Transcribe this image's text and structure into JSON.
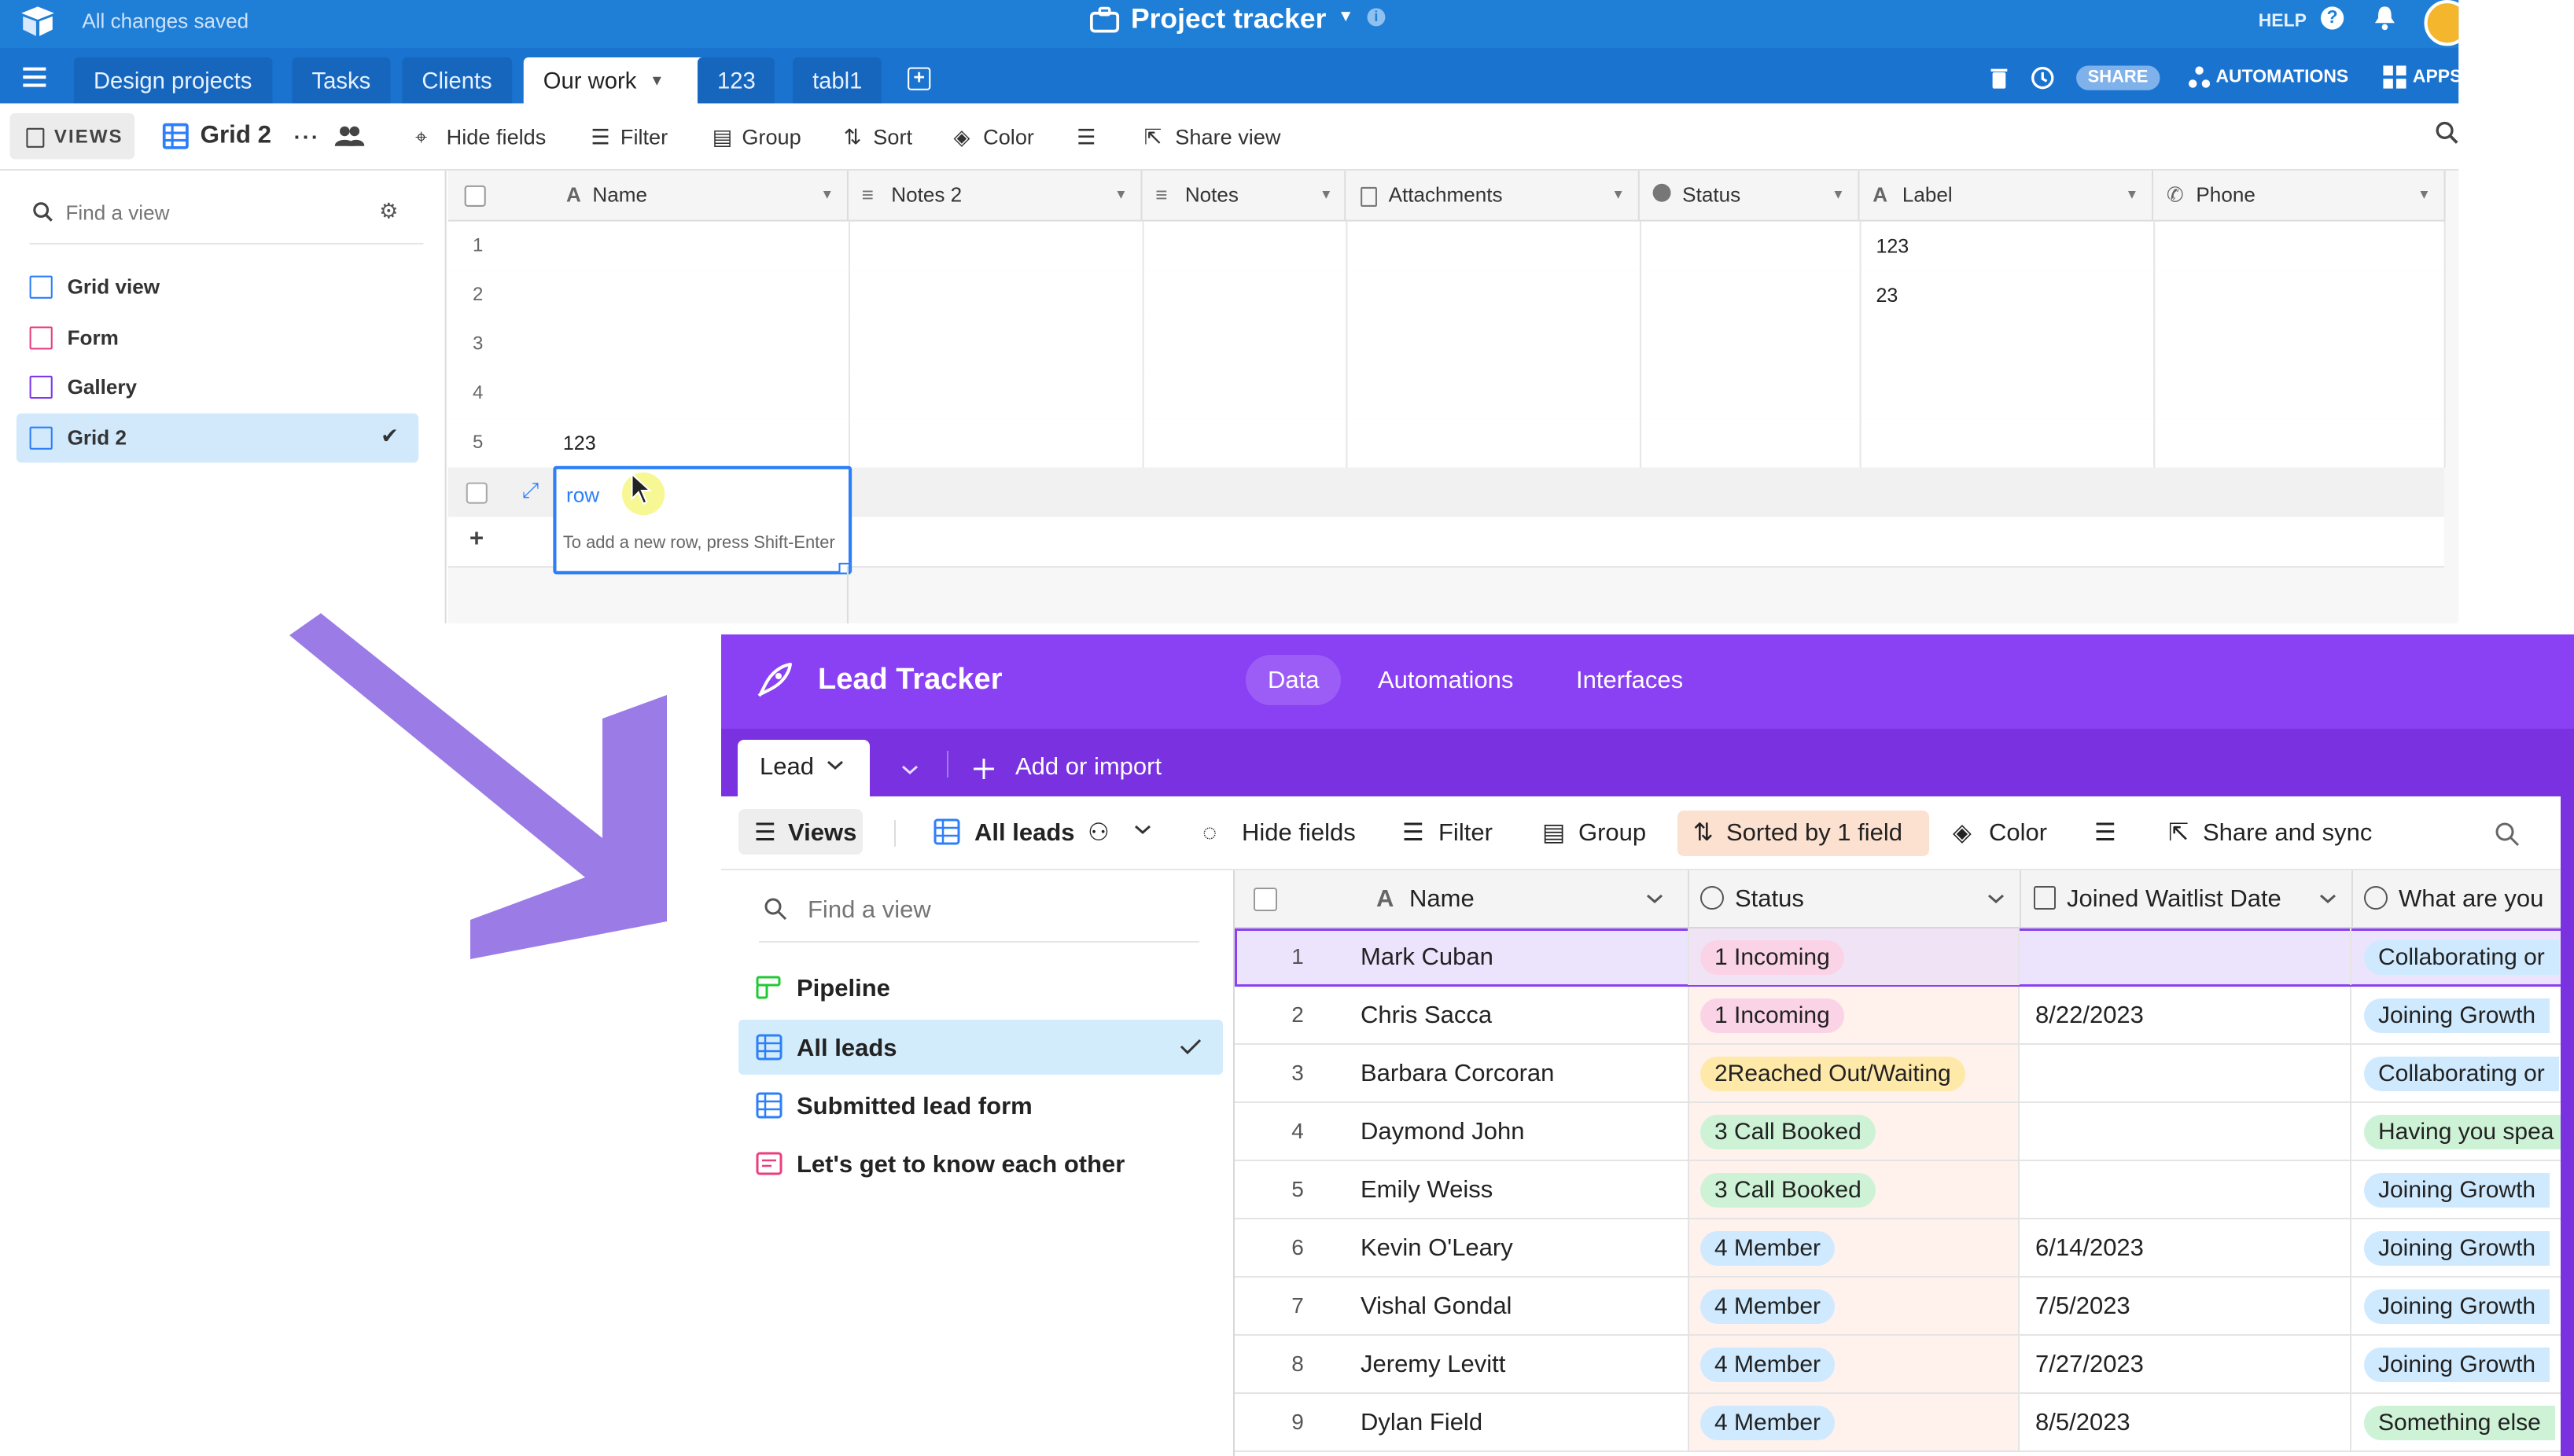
{
  "old_app": {
    "saved_status": "All changes saved",
    "base_title": "Project tracker",
    "help": "HELP",
    "tabs": [
      "Design projects",
      "Tasks",
      "Clients",
      "Our work",
      "123",
      "tabl1"
    ],
    "active_tab": "Our work",
    "share": "SHARE",
    "automations": "AUTOMATIONS",
    "apps": "APPS",
    "toolbar": {
      "views": "VIEWS",
      "view_name": "Grid 2",
      "hide_fields": "Hide fields",
      "filter": "Filter",
      "group": "Group",
      "sort": "Sort",
      "color": "Color",
      "share_view": "Share view"
    },
    "sidebar": {
      "search_placeholder": "Find a view",
      "views": [
        "Grid view",
        "Form",
        "Gallery",
        "Grid 2"
      ],
      "active_view": "Grid 2"
    },
    "columns": [
      "Name",
      "Notes 2",
      "Notes",
      "Attachments",
      "Status",
      "Label",
      "Phone"
    ],
    "rows": [
      {
        "num": "1",
        "name": "",
        "label": "123"
      },
      {
        "num": "2",
        "name": "",
        "label": "23"
      },
      {
        "num": "3",
        "name": "",
        "label": ""
      },
      {
        "num": "4",
        "name": "",
        "label": ""
      },
      {
        "num": "5",
        "name": "123",
        "label": ""
      }
    ],
    "editing_cell_value": "row",
    "editing_hint": "To add a new row, press Shift-Enter"
  },
  "new_app": {
    "title": "Lead Tracker",
    "nav": [
      "Data",
      "Automations",
      "Interfaces"
    ],
    "active_nav": "Data",
    "table_tab": "Lead",
    "add_or_import": "Add or import",
    "toolbar": {
      "views": "Views",
      "view_name": "All leads",
      "hide_fields": "Hide fields",
      "filter": "Filter",
      "group": "Group",
      "sorted": "Sorted by 1 field",
      "color": "Color",
      "share_sync": "Share and sync"
    },
    "sidebar": {
      "search_placeholder": "Find a view",
      "views": [
        "Pipeline",
        "All leads",
        "Submitted lead form",
        "Let's get to know each other"
      ],
      "active_view": "All leads"
    },
    "columns": [
      "Name",
      "Status",
      "Joined Waitlist Date",
      "What are you"
    ],
    "rows": [
      {
        "num": "1",
        "name": "Mark Cuban",
        "status": "1 Incoming",
        "date": "",
        "what": "Collaborating or"
      },
      {
        "num": "2",
        "name": "Chris Sacca",
        "status": "1 Incoming",
        "date": "8/22/2023",
        "what": "Joining Growth"
      },
      {
        "num": "3",
        "name": "Barbara Corcoran",
        "status": "2Reached Out/Waiting",
        "date": "",
        "what": "Collaborating or"
      },
      {
        "num": "4",
        "name": "Daymond John",
        "status": "3 Call Booked",
        "date": "",
        "what": "Having you spea"
      },
      {
        "num": "5",
        "name": "Emily Weiss",
        "status": "3 Call Booked",
        "date": "",
        "what": "Joining Growth"
      },
      {
        "num": "6",
        "name": "Kevin O'Leary",
        "status": "4 Member",
        "date": "6/14/2023",
        "what": "Joining Growth"
      },
      {
        "num": "7",
        "name": "Vishal Gondal",
        "status": "4 Member",
        "date": "7/5/2023",
        "what": "Joining Growth"
      },
      {
        "num": "8",
        "name": "Jeremy Levitt",
        "status": "4 Member",
        "date": "7/27/2023",
        "what": "Joining Growth"
      },
      {
        "num": "9",
        "name": "Dylan Field",
        "status": "4 Member",
        "date": "8/5/2023",
        "what": "Something else"
      }
    ]
  },
  "colors": {
    "old_blue": "#1f7fd6",
    "new_purple": "#8a40f3",
    "arrow_purple": "#9b7be6",
    "incoming_pill": "#fbd3e6",
    "reached_pill": "#ffe9a8",
    "booked_pill": "#cdf2d6",
    "member_pill": "#cfeafe",
    "what_blue_pill": "#cfeafe",
    "what_green_pill": "#cdf2d6",
    "sorted_bg": "#fde1d0"
  }
}
